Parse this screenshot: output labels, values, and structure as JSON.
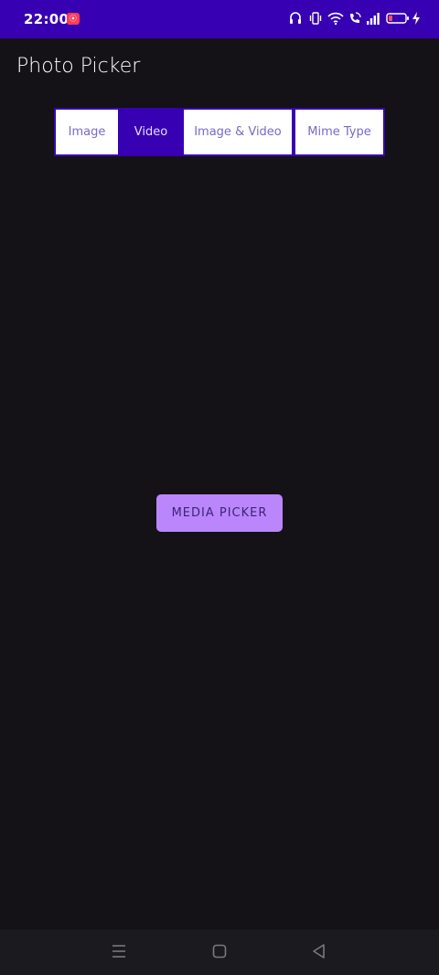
{
  "status_bar": {
    "time": "22:00",
    "icons": [
      "screen-record-icon",
      "headphones-icon",
      "vibrate-icon",
      "wifi-icon",
      "wifi-calling-icon",
      "signal-icon",
      "battery-icon",
      "charging-icon"
    ],
    "background": "#3700b3"
  },
  "app": {
    "title": "Photo Picker"
  },
  "tabs": [
    {
      "label": "Image",
      "selected": false
    },
    {
      "label": "Video",
      "selected": true
    },
    {
      "label": "Image & Video",
      "selected": false
    },
    {
      "label": "Mime Type",
      "selected": false
    }
  ],
  "media_picker_button": {
    "label": "MEDIA PICKER",
    "color": "#bb86fc"
  },
  "nav_bar": {
    "icons": [
      "menu-icon",
      "home-icon",
      "back-icon"
    ]
  },
  "colors": {
    "primary": "#3700b3",
    "accent": "#bb86fc",
    "background": "#141216"
  }
}
